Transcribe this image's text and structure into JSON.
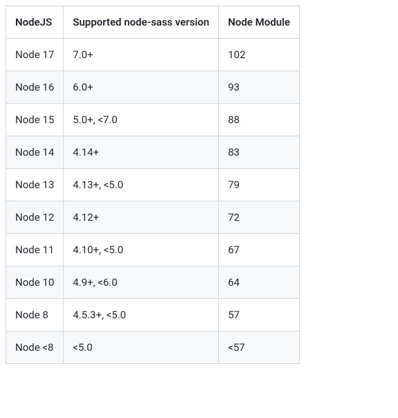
{
  "table": {
    "headers": [
      "NodeJS",
      "Supported node-sass version",
      "Node Module"
    ],
    "rows": [
      {
        "nodejs": "Node 17",
        "sass": "7.0+",
        "module": "102"
      },
      {
        "nodejs": "Node 16",
        "sass": "6.0+",
        "module": "93"
      },
      {
        "nodejs": "Node 15",
        "sass": "5.0+, <7.0",
        "module": "88"
      },
      {
        "nodejs": "Node 14",
        "sass": "4.14+",
        "module": "83"
      },
      {
        "nodejs": "Node 13",
        "sass": "4.13+, <5.0",
        "module": "79"
      },
      {
        "nodejs": "Node 12",
        "sass": "4.12+",
        "module": "72"
      },
      {
        "nodejs": "Node 11",
        "sass": "4.10+, <5.0",
        "module": "67"
      },
      {
        "nodejs": "Node 10",
        "sass": "4.9+, <6.0",
        "module": "64"
      },
      {
        "nodejs": "Node 8",
        "sass": "4.5.3+, <5.0",
        "module": "57"
      },
      {
        "nodejs": "Node <8",
        "sass": "<5.0",
        "module": "<57"
      }
    ]
  }
}
